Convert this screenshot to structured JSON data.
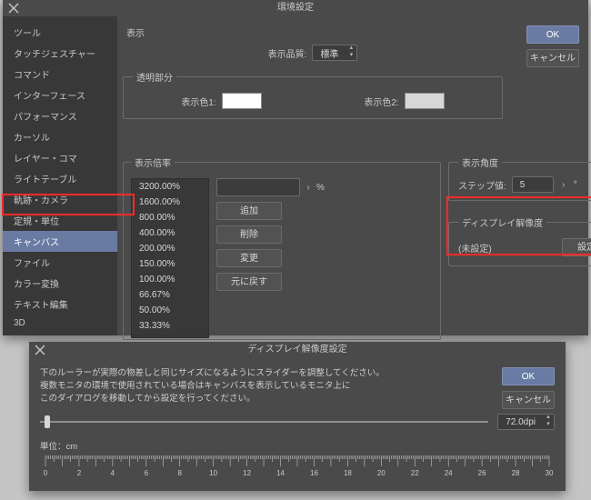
{
  "main": {
    "title": "環境設定",
    "buttons": {
      "ok": "OK",
      "cancel": "キャンセル"
    },
    "sidebar": [
      "ツール",
      "タッチジェスチャー",
      "コマンド",
      "インターフェース",
      "パフォーマンス",
      "カーソル",
      "レイヤー・コマ",
      "ライトテーブル",
      "軌跡・カメラ",
      "定規・単位",
      "キャンバス",
      "ファイル",
      "カラー変換",
      "テキスト編集",
      "3D"
    ],
    "sidebar_selected_index": 10,
    "display": {
      "legend": "表示",
      "quality_label": "表示品質:",
      "quality_value": "標準",
      "transparency_legend": "透明部分",
      "color1_label": "表示色1:",
      "color1_value": "#ffffff",
      "color2_label": "表示色2:",
      "color2_value": "#d7d7d7"
    },
    "zoom": {
      "legend": "表示倍率",
      "list": [
        "3200.00%",
        "1600.00%",
        "800.00%",
        "400.00%",
        "200.00%",
        "150.00%",
        "100.00%",
        "66.67%",
        "50.00%",
        "33.33%"
      ],
      "input_value": "",
      "percent_symbol": "%",
      "btn_add": "追加",
      "btn_delete": "削除",
      "btn_change": "変更",
      "btn_reset": "元に戻す"
    },
    "angle": {
      "legend": "表示角度",
      "step_label": "ステップ値:",
      "step_value": "5",
      "degree_symbol": "°"
    },
    "disp_res": {
      "legend": "ディスプレイ解像度",
      "status": "(未設定)",
      "btn_set": "設定"
    }
  },
  "sub": {
    "title": "ディスプレイ解像度設定",
    "buttons": {
      "ok": "OK",
      "cancel": "キャンセル"
    },
    "desc_lines": [
      "下のルーラーが実際の物差しと同じサイズになるようにスライダーを調整してください。",
      "複数モニタの環境で使用されている場合はキャンバスを表示しているモニタ上に",
      "このダイアログを移動してから設定を行ってください。"
    ],
    "dpi_value": "72.0dpi",
    "unit_label": "単位：cm",
    "slider_pos_pct": 1,
    "ruler_max_cm": 30
  }
}
